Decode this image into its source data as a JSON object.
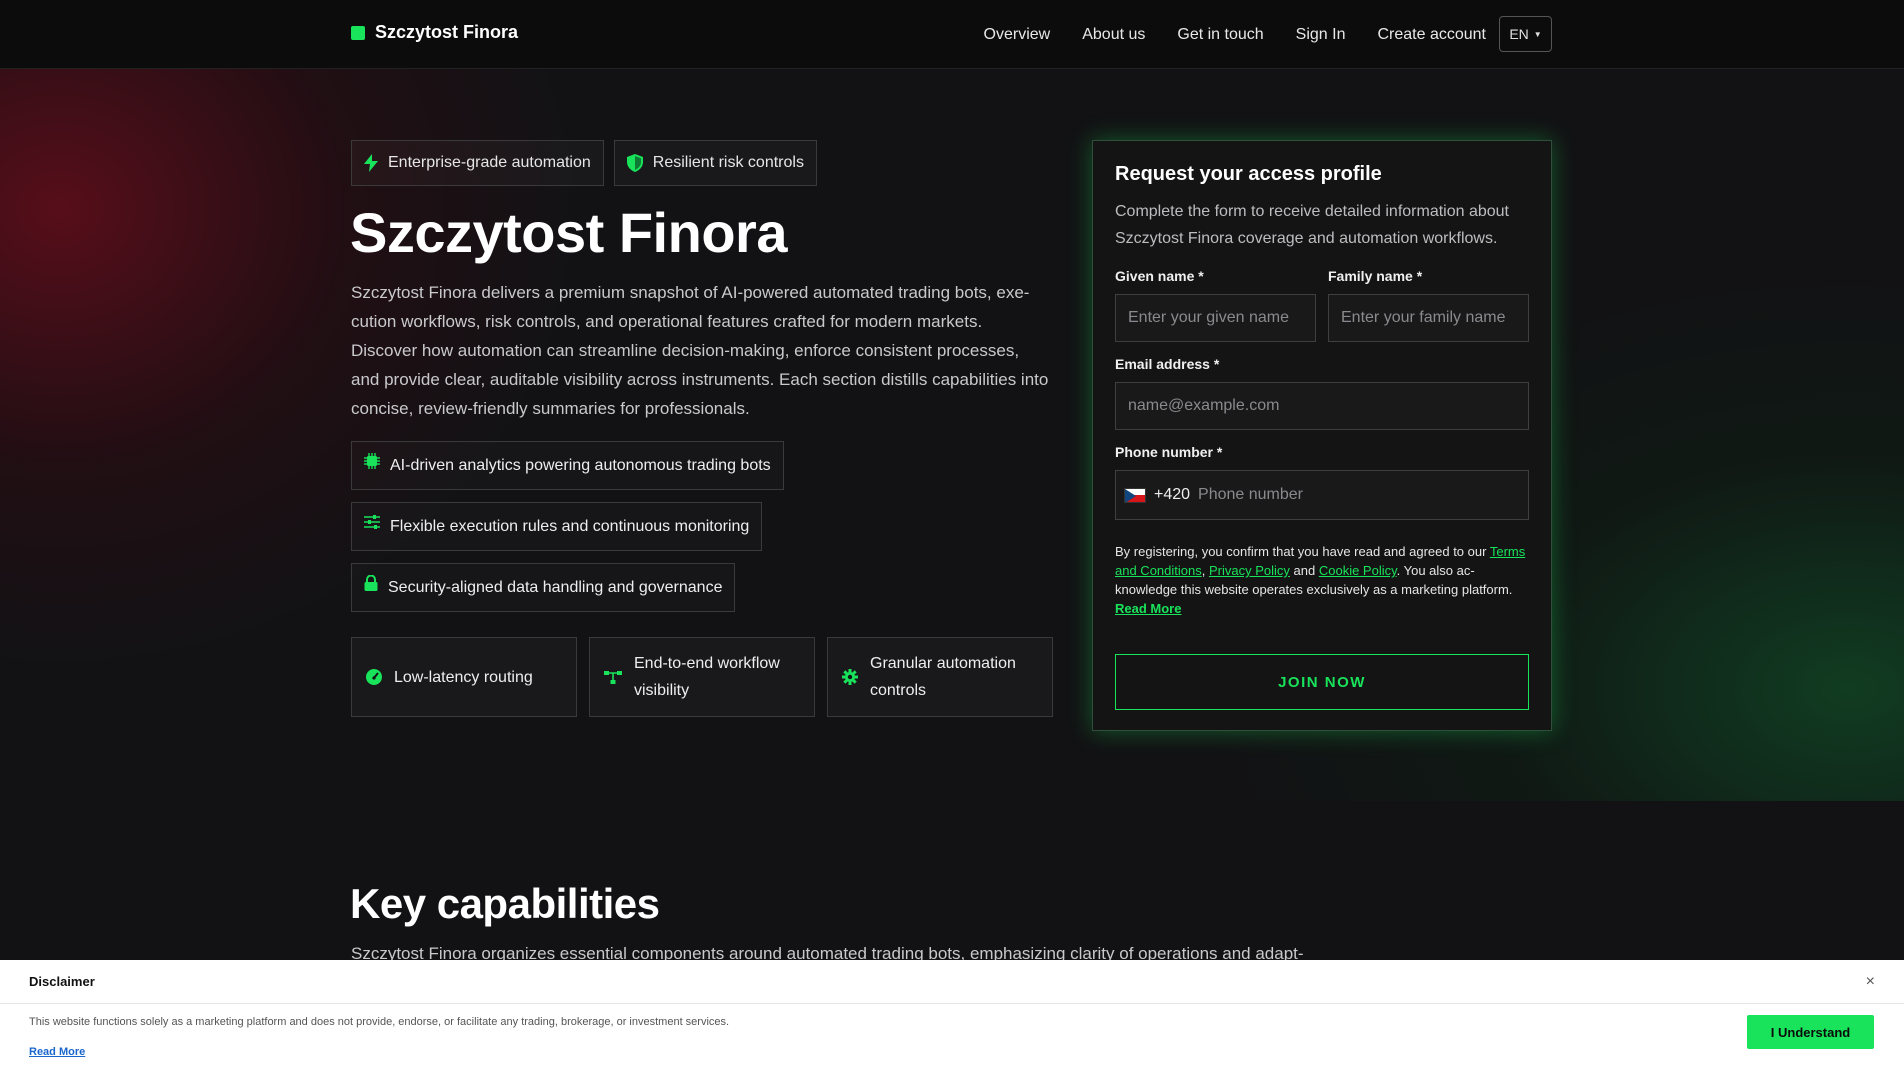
{
  "brand": {
    "name": "Szczytost Finora",
    "accent": "#19e35a"
  },
  "nav": {
    "items": [
      "Overview",
      "About us",
      "Get in touch",
      "Sign In",
      "Create account"
    ],
    "lang": "EN"
  },
  "hero": {
    "badges": [
      {
        "icon": "bolt-icon",
        "label": "Enterprise-grade automation"
      },
      {
        "icon": "shield-icon",
        "label": "Resilient risk controls"
      }
    ],
    "title": "Szczytost Finora",
    "description": "Szczytost Finora delivers a premium snapshot of AI-powered automated trading bots, exe-cution workflows, risk controls, and operational features crafted for modern markets. Discover how automation can streamline decision-making, enforce consistent processes, and provide clear, auditable visibility across instruments. Each section distills capabilities into concise, review-friendly summaries for professionals.",
    "features": [
      {
        "icon": "chip-icon",
        "label": "AI-driven analytics powering autonomous trading bots"
      },
      {
        "icon": "sliders-icon",
        "label": "Flexible execution rules and continuous monitoring"
      },
      {
        "icon": "lock-icon",
        "label": "Security-aligned data handling and governance"
      }
    ],
    "cards": [
      {
        "icon": "gauge-icon",
        "label": "Low-latency routing"
      },
      {
        "icon": "workflow-icon",
        "label": "End-to-end workflow visibility"
      },
      {
        "icon": "gear-icon",
        "label": "Granular automation controls"
      }
    ]
  },
  "form": {
    "title": "Request your access profile",
    "subtitle": "Complete the form to receive detailed information about Szczytost Finora coverage and automation workflows.",
    "given_label": "Given name *",
    "given_placeholder": "Enter your given name",
    "family_label": "Family name *",
    "family_placeholder": "Enter your family name",
    "email_label": "Email address *",
    "email_placeholder": "name@example.com",
    "phone_label": "Phone number *",
    "phone_dial": "+420",
    "phone_placeholder": "Phone number",
    "consent_prefix": "By registering, you confirm that you have read and agreed to our",
    "terms": "Terms and Conditions",
    "privacy": "Privacy Policy",
    "and": "and",
    "cookie": "Cookie Policy",
    "consent_suffix": ". You also ac-knowledge this website operates exclusively as a marketing platform.",
    "read_more": "Read More",
    "submit": "JOIN NOW"
  },
  "capabilities": {
    "title": "Key capabilities",
    "description": "Szczytost Finora organizes essential components around automated trading bots, emphasizing clarity of operations and adapt-"
  },
  "disclaimer": {
    "title": "Disclaimer",
    "text": "This website functions solely as a marketing platform and does not provide, endorse, or facilitate any trading, brokerage, or investment services.",
    "read_more": "Read More",
    "button": "I Understand",
    "close": "×"
  }
}
